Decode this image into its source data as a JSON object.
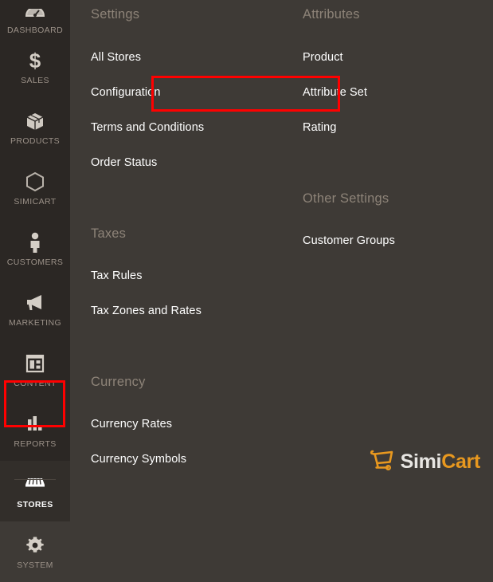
{
  "colors": {
    "sidebar_bg": "#2b2724",
    "panel_bg": "#3e3a36",
    "highlight_red": "#ff0000",
    "group_title": "#8d8378",
    "link": "#ffffff",
    "brand_orange": "#e8981f"
  },
  "sidebar": {
    "items": [
      {
        "label": "DASHBOARD",
        "icon": "gauge-icon",
        "active": false
      },
      {
        "label": "SALES",
        "icon": "dollar-icon",
        "active": false
      },
      {
        "label": "PRODUCTS",
        "icon": "box-icon",
        "active": false
      },
      {
        "label": "SIMICART",
        "icon": "hexagon-icon",
        "active": false
      },
      {
        "label": "CUSTOMERS",
        "icon": "person-icon",
        "active": false
      },
      {
        "label": "MARKETING",
        "icon": "megaphone-icon",
        "active": false
      },
      {
        "label": "CONTENT",
        "icon": "layout-icon",
        "active": false
      },
      {
        "label": "REPORTS",
        "icon": "bar-chart-icon",
        "active": false
      },
      {
        "label": "STORES",
        "icon": "storefront-icon",
        "active": true
      },
      {
        "label": "SYSTEM",
        "icon": "gear-icon",
        "active": false
      }
    ]
  },
  "menu": {
    "columns": [
      {
        "groups": [
          {
            "title": "Settings",
            "items": [
              {
                "label": "All Stores"
              },
              {
                "label": "Configuration",
                "highlighted": true
              },
              {
                "label": "Terms and Conditions"
              },
              {
                "label": "Order Status"
              }
            ]
          },
          {
            "title": "Taxes",
            "items": [
              {
                "label": "Tax Rules"
              },
              {
                "label": "Tax Zones and Rates"
              }
            ]
          },
          {
            "title": "Currency",
            "items": [
              {
                "label": "Currency Rates"
              },
              {
                "label": "Currency Symbols"
              }
            ]
          }
        ]
      },
      {
        "groups": [
          {
            "title": "Attributes",
            "items": [
              {
                "label": "Product"
              },
              {
                "label": "Attribute Set"
              },
              {
                "label": "Rating"
              }
            ]
          },
          {
            "title": "Other Settings",
            "items": [
              {
                "label": "Customer Groups"
              }
            ]
          }
        ]
      }
    ]
  },
  "logo": {
    "icon": "shopping-cart-icon",
    "text_primary": "Simi",
    "text_accent": "Cart"
  }
}
